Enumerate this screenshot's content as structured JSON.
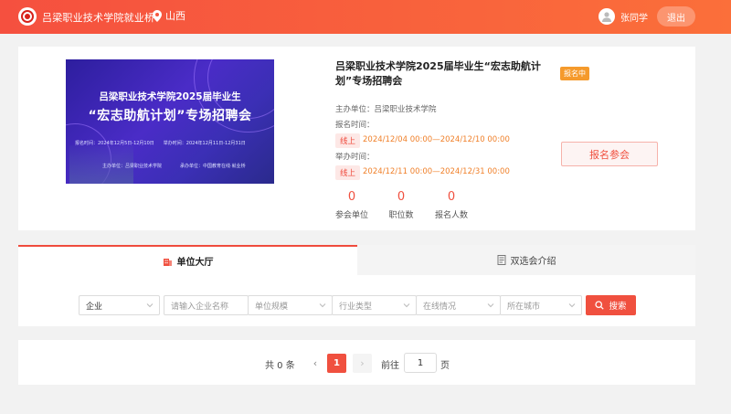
{
  "header": {
    "site_title": "吕梁职业技术学院就业桥",
    "location": "山西",
    "username": "张同学",
    "logout_label": "退出"
  },
  "fair": {
    "banner_line1": "吕梁职业技术学院2025届毕业生",
    "banner_line2": "“宏志助航计划”专场招聘会",
    "banner_dates": "报名时间：2024年12月5日-12月10日　　举办时间：2024年12月11日-12月31日",
    "banner_org": "主办单位：吕梁职业技术学院　　　　承办单位：中国教育在线·就业桥",
    "title": "吕梁职业技术学院2025届毕业生“宏志助航计划”专场招聘会",
    "status": "报名中",
    "organizer_label": "主办单位：",
    "organizer": "吕梁职业技术学院",
    "signup_time_label": "报名时间：",
    "signup_mode": "线上",
    "signup_time": "2024/12/04 00:00—2024/12/10 00:00",
    "hold_time_label": "举办时间：",
    "hold_mode": "线上",
    "hold_time": "2024/12/11 00:00—2024/12/31 00:00",
    "signup_button": "报名参会",
    "stats": [
      {
        "value": "0",
        "label": "参会单位"
      },
      {
        "value": "0",
        "label": "职位数"
      },
      {
        "value": "0",
        "label": "报名人数"
      }
    ]
  },
  "tabs": [
    {
      "label": "单位大厅",
      "active": true
    },
    {
      "label": "双选会介绍",
      "active": false
    }
  ],
  "filters": {
    "type_value": "企业",
    "name_placeholder": "请输入企业名称",
    "scale_placeholder": "单位规模",
    "industry_placeholder": "行业类型",
    "online_placeholder": "在线情况",
    "city_placeholder": "所在城市",
    "search_label": "搜索"
  },
  "pagination": {
    "total": "共 0 条",
    "prev": "‹",
    "current": "1",
    "next": "›",
    "goto_label": "前往",
    "goto_value": "1",
    "page_unit": "页"
  },
  "colors": {
    "accent": "#f0503f",
    "header_start": "#f5503f",
    "header_end": "#fb6f3a",
    "status_badge": "#f59a2c",
    "time_text": "#f0802a"
  }
}
